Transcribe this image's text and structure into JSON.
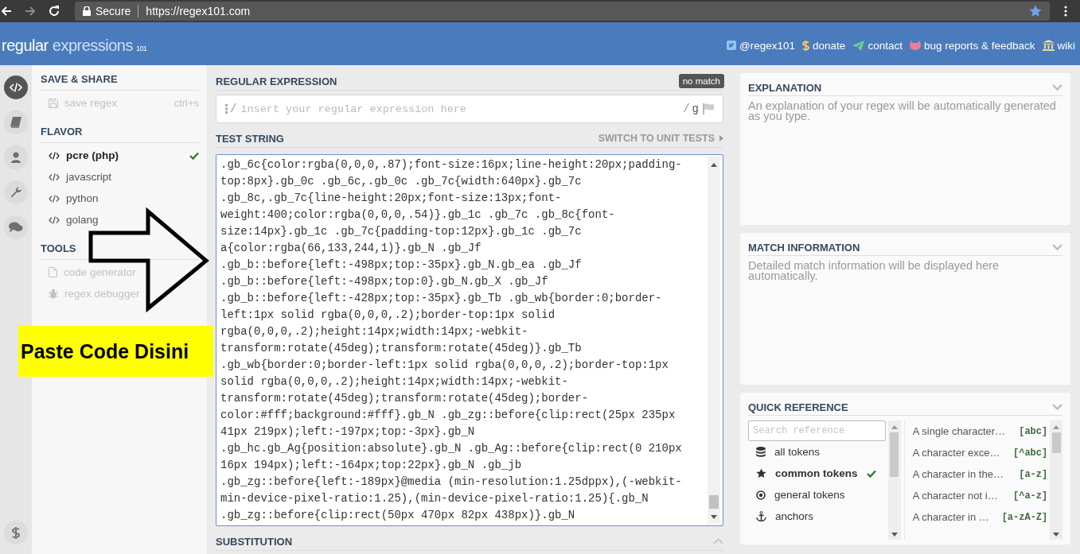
{
  "browser": {
    "secure_label": "Secure",
    "url": "https://regex101.com"
  },
  "header": {
    "logo_main": "regular",
    "logo_rest": "expressions",
    "logo_sup": "101",
    "links": [
      {
        "kind": "twitter",
        "label": "@regex101"
      },
      {
        "kind": "donate",
        "label": "donate"
      },
      {
        "kind": "contact",
        "label": "contact"
      },
      {
        "kind": "bug",
        "label": "bug reports & feedback"
      },
      {
        "kind": "wiki",
        "label": "wiki"
      }
    ]
  },
  "nav_icons": [
    {
      "kind": "code",
      "selected": true
    },
    {
      "kind": "book",
      "selected": false
    },
    {
      "kind": "user",
      "selected": false
    },
    {
      "kind": "wrench",
      "selected": false
    },
    {
      "kind": "chat",
      "selected": false
    }
  ],
  "sidebar": [
    {
      "title": "SAVE & SHARE",
      "items": [
        {
          "kind": "save",
          "label": "save regex",
          "shortcut": "ctrl+s",
          "disabled": true
        }
      ]
    },
    {
      "title": "FLAVOR",
      "items": [
        {
          "kind": "flavor",
          "label": "pcre (php)",
          "selected": true
        },
        {
          "kind": "flavor",
          "label": "javascript",
          "selected": false
        },
        {
          "kind": "flavor",
          "label": "python",
          "selected": false
        },
        {
          "kind": "flavor",
          "label": "golang",
          "selected": false
        }
      ]
    },
    {
      "title": "TOOLS",
      "items": [
        {
          "kind": "codegen",
          "label": "code generator",
          "disabled": true
        },
        {
          "kind": "debugger",
          "label": "regex debugger",
          "disabled": true
        }
      ]
    }
  ],
  "regex": {
    "title": "REGULAR EXPRESSION",
    "badge": "no match",
    "delimiter_open": "/",
    "placeholder": "insert your regular expression here",
    "delimiter_close": "/",
    "flags": "g"
  },
  "test_string": {
    "title": "TEST STRING",
    "switch_link": "SWITCH TO UNIT TESTS",
    "lines": [
      ".gb_6c{color:rgba(0,0,0,.87);font-size:16px;line-height:20px;padding-",
      "top:8px}.gb_0c .gb_6c,.gb_0c .gb_7c{width:640px}.gb_7c",
      ".gb_8c,.gb_7c{line-height:20px;font-size:13px;font-",
      "weight:400;color:rgba(0,0,0,.54)}.gb_1c .gb_7c .gb_8c{font-",
      "size:14px}.gb_1c .gb_7c{padding-top:12px}.gb_1c .gb_7c",
      "a{color:rgba(66,133,244,1)}.gb_N .gb_Jf",
      ".gb_b::before{left:-498px;top:-35px}.gb_N.gb_ea .gb_Jf",
      ".gb_b::before{left:-498px;top:0}.gb_N.gb_X .gb_Jf",
      ".gb_b::before{left:-428px;top:-35px}.gb_Tb .gb_wb{border:0;border-",
      "left:1px solid rgba(0,0,0,.2);border-top:1px solid",
      "rgba(0,0,0,.2);height:14px;width:14px;-webkit-",
      "transform:rotate(45deg);transform:rotate(45deg)}.gb_Tb",
      ".gb_wb{border:0;border-left:1px solid rgba(0,0,0,.2);border-top:1px",
      "solid rgba(0,0,0,.2);height:14px;width:14px;-webkit-",
      "transform:rotate(45deg);transform:rotate(45deg);border-",
      "color:#fff;background:#fff}.gb_N .gb_zg::before{clip:rect(25px 235px",
      "41px 219px);left:-197px;top:-3px}.gb_N",
      ".gb_hc.gb_Ag{position:absolute}.gb_N .gb_Ag::before{clip:rect(0 210px",
      "16px 194px);left:-164px;top:22px}.gb_N .gb_jb",
      ".gb_zg::before{left:-189px}@media (min-resolution:1.25dppx),(-webkit-",
      "min-device-pixel-ratio:1.25),(min-device-pixel-ratio:1.25){.gb_N",
      ".gb_zg::before{clip:rect(50px 470px 82px 438px)}.gb_N"
    ]
  },
  "substitution": {
    "title": "SUBSTITUTION"
  },
  "panels": [
    {
      "title": "EXPLANATION",
      "text": "An explanation of your regex will be automatically generated as you type."
    },
    {
      "title": "MATCH INFORMATION",
      "text": "Detailed match information will be displayed here automatically."
    }
  ],
  "quick_reference": {
    "title": "QUICK REFERENCE",
    "search": {
      "placeholder": "Search reference"
    },
    "categories": [
      {
        "kind": "all",
        "label": "all tokens",
        "selected": false
      },
      {
        "kind": "common",
        "label": "common tokens",
        "selected": true
      },
      {
        "kind": "general",
        "label": "general tokens",
        "selected": false
      },
      {
        "kind": "anchors",
        "label": "anchors",
        "selected": false
      }
    ],
    "tokens": [
      {
        "description": "A single character…",
        "token": "[abc]"
      },
      {
        "description": "A character exce…",
        "token": "[^abc]"
      },
      {
        "description": "A character in the…",
        "token": "[a-z]"
      },
      {
        "description": "A character not i…",
        "token": "[^a-z]"
      },
      {
        "description": "A character in …",
        "token": "[a-zA-Z]"
      }
    ]
  },
  "annotation": {
    "label": "Paste Code Disini"
  }
}
